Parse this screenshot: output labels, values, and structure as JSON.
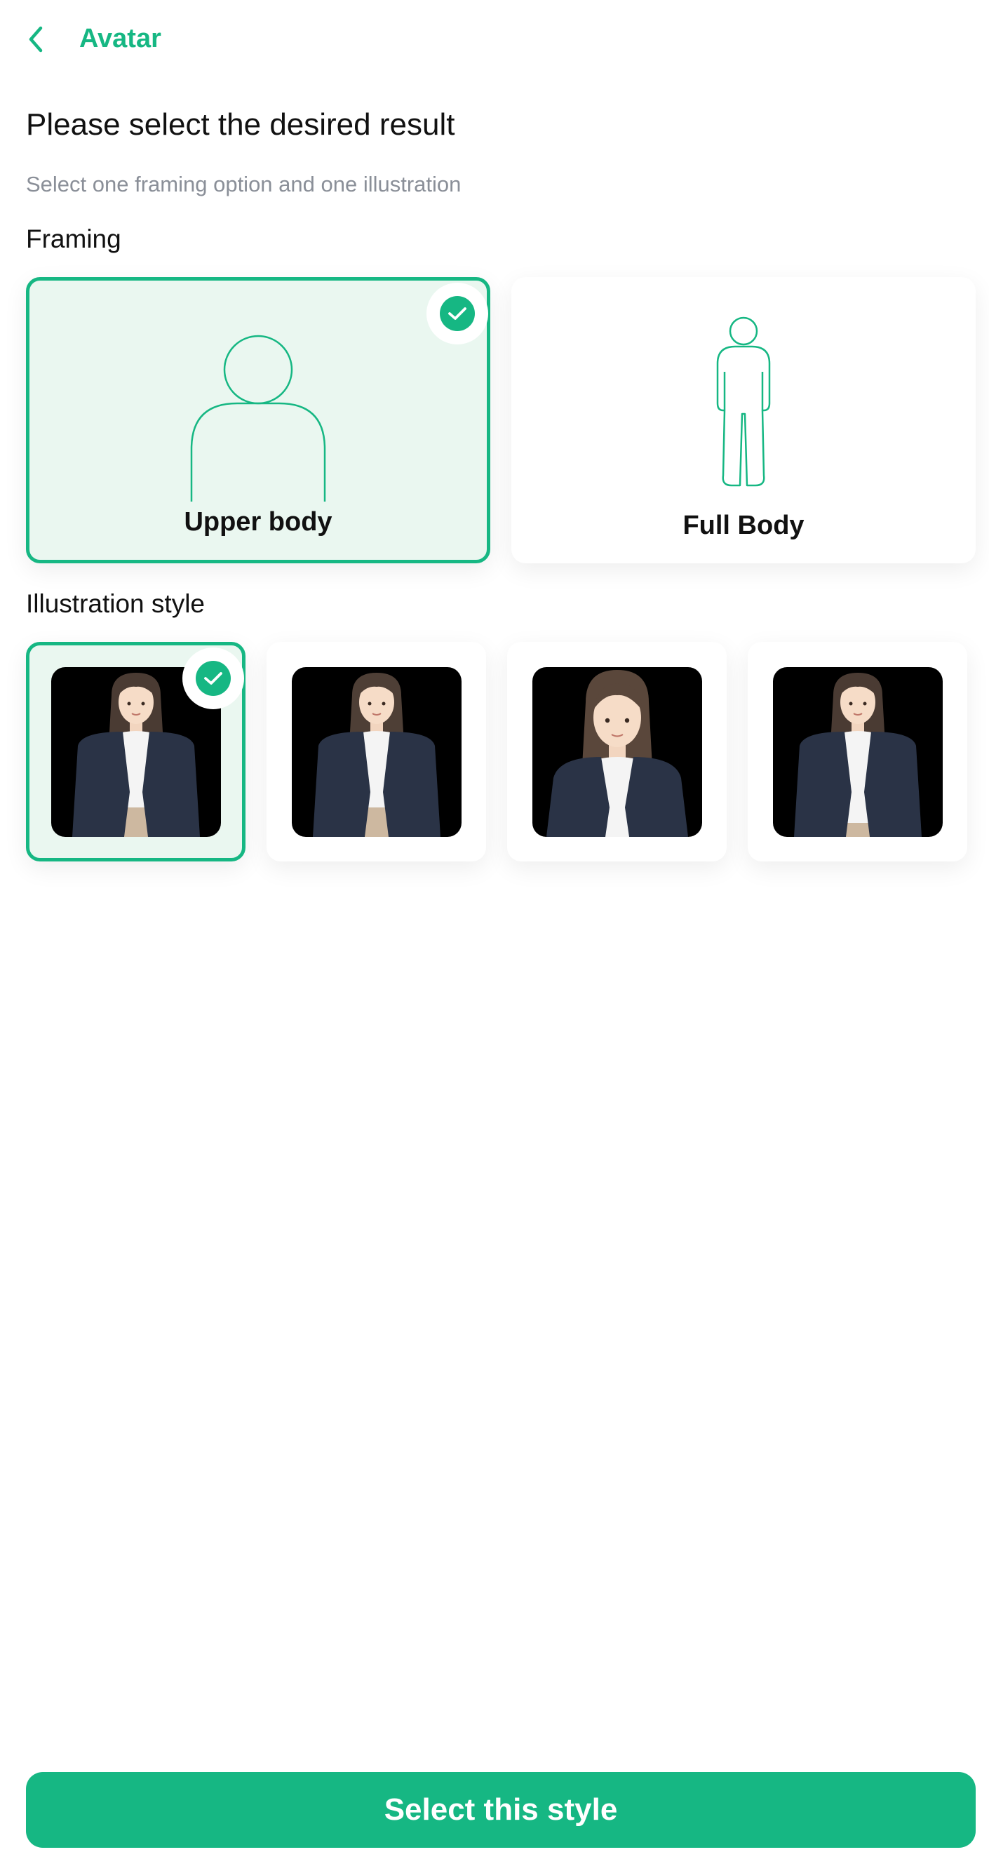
{
  "header": {
    "back_icon": "chevron-left-icon",
    "title": "Avatar"
  },
  "main": {
    "title": "Please select the desired result",
    "subtitle": "Select one framing option and one illustration",
    "framing": {
      "label": "Framing",
      "options": [
        {
          "label": "Upper body",
          "icon": "upper-body-icon",
          "selected": true
        },
        {
          "label": "Full Body",
          "icon": "full-body-icon",
          "selected": false
        }
      ]
    },
    "illustration": {
      "label": "Illustration style",
      "selected_index": 0,
      "options": [
        {
          "icon": "avatar-illustration",
          "selected": true
        },
        {
          "icon": "avatar-illustration",
          "selected": false
        },
        {
          "icon": "avatar-illustration",
          "selected": false
        },
        {
          "icon": "avatar-illustration",
          "selected": false
        }
      ]
    }
  },
  "footer": {
    "cta_label": "Select this style"
  },
  "colors": {
    "accent": "#16b783",
    "selected_bg": "#eaf7f0",
    "subtitle": "#8a8f98",
    "jacket": "#2a3346",
    "skirt": "#cdb8a0"
  }
}
